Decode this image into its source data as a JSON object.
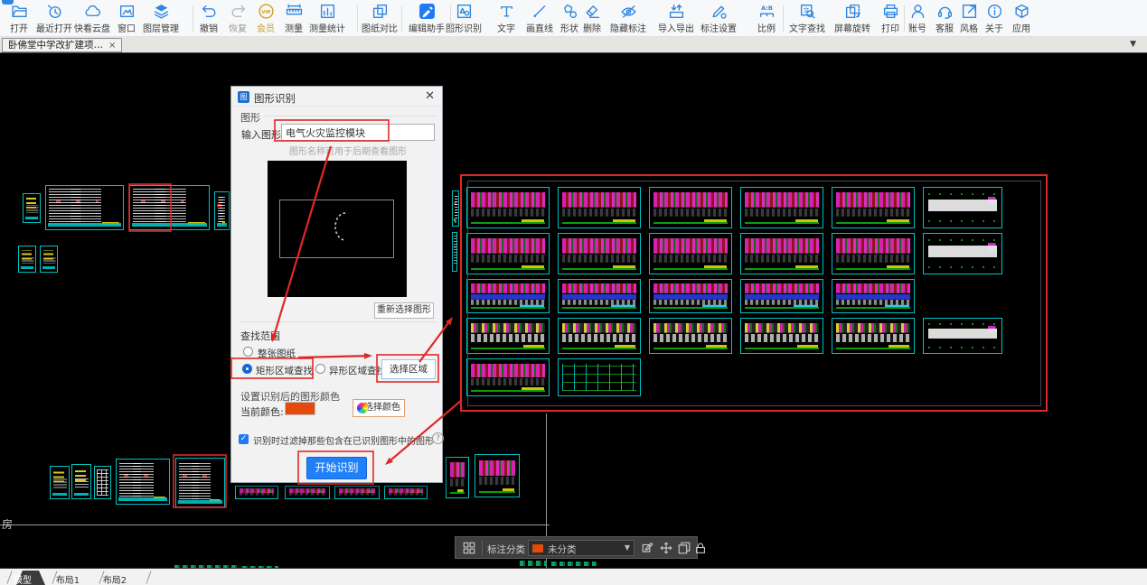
{
  "toolbar": {
    "items": [
      {
        "name": "open-button",
        "label": "打开",
        "icon": "folder-open-icon"
      },
      {
        "name": "recent-open-button",
        "label": "最近打开",
        "icon": "recent-open-icon"
      },
      {
        "name": "cloud-drive-button",
        "label": "快看云盘",
        "icon": "cloud-drive-icon"
      },
      {
        "name": "window-button",
        "label": "窗口",
        "icon": "window-icon"
      },
      {
        "name": "layer-manage-button",
        "label": "图层管理",
        "icon": "layer-manage-icon"
      },
      {
        "name": "undo-button",
        "label": "撤销",
        "icon": "undo-icon"
      },
      {
        "name": "redo-button",
        "label": "恢复",
        "icon": "redo-icon",
        "disabled": true
      },
      {
        "name": "vip-button",
        "label": "会员",
        "icon": "vip-icon",
        "gold": true
      },
      {
        "name": "measure-button",
        "label": "测量",
        "icon": "measure-icon"
      },
      {
        "name": "measure-stats-button",
        "label": "测量统计",
        "icon": "measure-stats-icon"
      },
      {
        "name": "drawing-compare-button",
        "label": "图纸对比",
        "icon": "drawing-compare-icon"
      },
      {
        "name": "edit-assistant-button",
        "label": "编辑助手",
        "icon": "edit-assistant-icon"
      },
      {
        "name": "shape-recognition-button",
        "label": "图形识别",
        "icon": "shape-recognition-icon"
      },
      {
        "name": "text-button",
        "label": "文字",
        "icon": "text-icon"
      },
      {
        "name": "draw-line-button",
        "label": "画直线",
        "icon": "draw-line-icon"
      },
      {
        "name": "shape-button",
        "label": "形状",
        "icon": "shape-icon"
      },
      {
        "name": "delete-button",
        "label": "删除",
        "icon": "delete-icon"
      },
      {
        "name": "hide-annotation-button",
        "label": "隐藏标注",
        "icon": "hide-annotation-icon"
      },
      {
        "name": "import-export-button",
        "label": "导入导出",
        "icon": "import-export-icon"
      },
      {
        "name": "annotation-settings-button",
        "label": "标注设置",
        "icon": "annotation-settings-icon"
      },
      {
        "name": "scale-button",
        "label": "比例",
        "icon": "scale-icon"
      },
      {
        "name": "text-search-button",
        "label": "文字查找",
        "icon": "text-search-icon"
      },
      {
        "name": "screen-rotate-button",
        "label": "屏幕旋转",
        "icon": "screen-rotate-icon"
      },
      {
        "name": "print-button",
        "label": "打印",
        "icon": "print-icon"
      },
      {
        "name": "account-button",
        "label": "账号",
        "icon": "account-icon"
      },
      {
        "name": "support-button",
        "label": "客服",
        "icon": "support-icon"
      },
      {
        "name": "style-button",
        "label": "风格",
        "icon": "style-icon"
      },
      {
        "name": "about-button",
        "label": "关于",
        "icon": "about-icon"
      },
      {
        "name": "apps-button",
        "label": "应用",
        "icon": "apps-icon"
      }
    ]
  },
  "doc_tab": {
    "title": "卧佛堂中学改扩建项…",
    "close": "×",
    "collapse_caret": "▼"
  },
  "dialog": {
    "title": "图形识别",
    "close": "✕",
    "graphic_group_label": "图形",
    "name_label": "输入图形名称:",
    "name_value": "电气火灾监控模块",
    "name_hint": "图形名称可用于后期查看图形",
    "reselect_button": "重新选择图形",
    "range_group_label": "查找范围",
    "radio_whole_drawing": "整张图纸",
    "radio_rect_area": "矩形区域查找",
    "radio_irregular_area": "异形区域查找",
    "select_area_button": "选择区域",
    "color_group_label": "设置识别后的图形颜色",
    "current_color_label": "当前颜色:",
    "current_color": "#e54a0c",
    "pick_color_button": "选择颜色",
    "filter_checkbox_checked": "✓",
    "filter_checkbox_label": "识别时过滤掉那些包含在已识别图形中的图形",
    "filter_help": "?",
    "start_button": "开始识别"
  },
  "bottom_toolbar": {
    "classify_label": "标注分类",
    "category_value": "未分类",
    "category_color": "#e54a0c",
    "caret": "▼"
  },
  "layout_tabs": [
    {
      "label": "模型",
      "active": true
    },
    {
      "label": "布局1",
      "active": false
    },
    {
      "label": "布局2",
      "active": false
    }
  ],
  "canvas": {
    "stray_text": "房"
  },
  "colors": {
    "accent_blue": "#2e86e0",
    "annotation_red": "#e02828",
    "thumbnail_cyan": "#00c2c2",
    "canvas_black": "#000000"
  }
}
